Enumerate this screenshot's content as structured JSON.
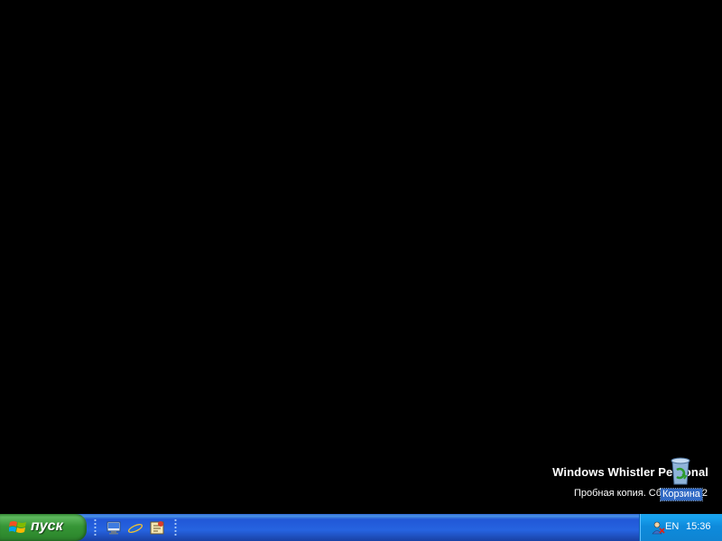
{
  "desktop": {
    "background_color": "#000000",
    "watermark": {
      "title": "Windows Whistler Personal",
      "subtitle": "Пробная копия. Сборка 2462"
    },
    "icons": [
      {
        "label": "Корзина",
        "icon": "recycle-bin-icon"
      }
    ]
  },
  "taskbar": {
    "start_label": "пуск",
    "quick_launch": [
      {
        "icon": "show-desktop-icon"
      },
      {
        "icon": "internet-explorer-icon"
      },
      {
        "icon": "media-player-icon"
      }
    ],
    "tray": {
      "language": "EN",
      "clock": "15:36",
      "icons": [
        "user-status-icon"
      ]
    }
  }
}
